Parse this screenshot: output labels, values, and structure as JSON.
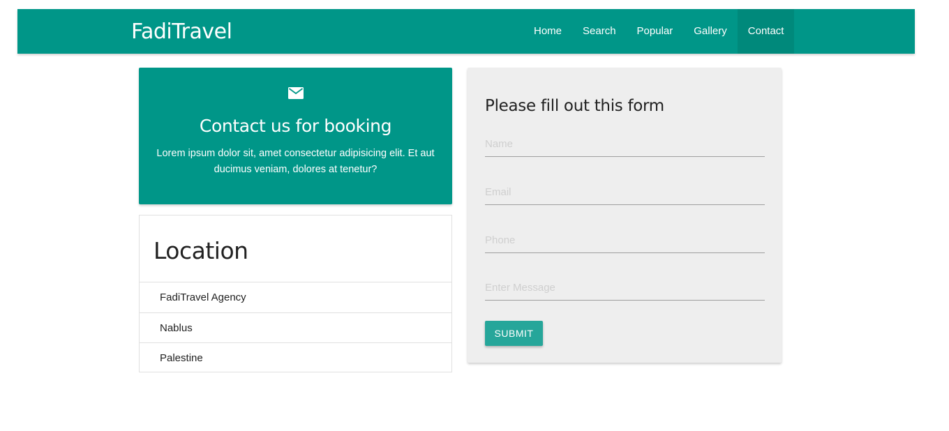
{
  "navbar": {
    "brand": "FadiTravel",
    "links": [
      {
        "label": "Home",
        "active": false
      },
      {
        "label": "Search",
        "active": false
      },
      {
        "label": "Popular",
        "active": false
      },
      {
        "label": "Gallery",
        "active": false
      },
      {
        "label": "Contact",
        "active": true
      }
    ]
  },
  "contact_card": {
    "icon": "mail-icon",
    "title": "Contact us for booking",
    "text": "Lorem ipsum dolor sit, amet consectetur adipisicing elit. Et aut ducimus veniam, dolores at tenetur?"
  },
  "location": {
    "title": "Location",
    "items": [
      "FadiTravel Agency",
      "Nablus",
      "Palestine"
    ]
  },
  "form": {
    "title": "Please fill out this form",
    "name_placeholder": "Name",
    "email_placeholder": "Email",
    "phone_placeholder": "Phone",
    "message_placeholder": "Enter Message",
    "submit_label": "SUBMIT"
  },
  "colors": {
    "primary": "#009688",
    "active_nav": "#00897b",
    "button": "#26a69a",
    "form_bg": "#eeeeee"
  }
}
